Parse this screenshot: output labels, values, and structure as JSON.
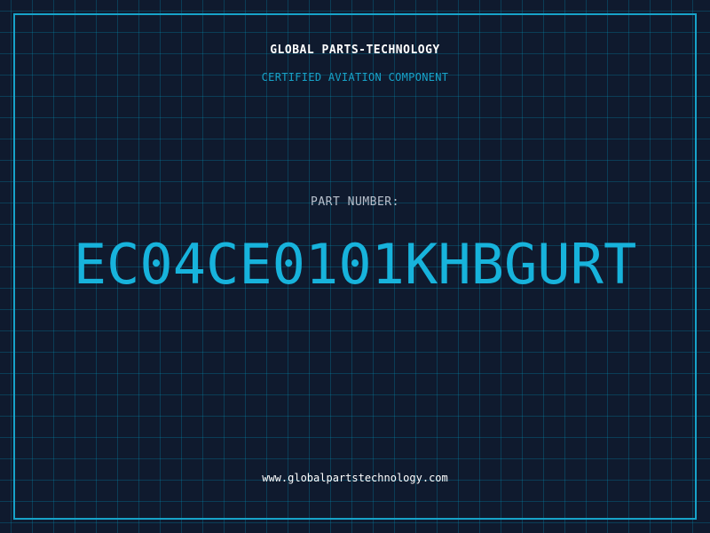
{
  "card": {
    "company": "GLOBAL PARTS-TECHNOLOGY",
    "subtitle": "CERTIFIED AVIATION COMPONENT",
    "part_number_label": "PART NUMBER:",
    "part_number": "EC04CE0101KHBGURT",
    "website": "www.globalpartstechnology.com"
  },
  "colors": {
    "background": "#0f1a2e",
    "accent": "#17a3c9",
    "part_number": "#17b3dc",
    "label": "#b8c0cc",
    "title": "#ffffff"
  }
}
